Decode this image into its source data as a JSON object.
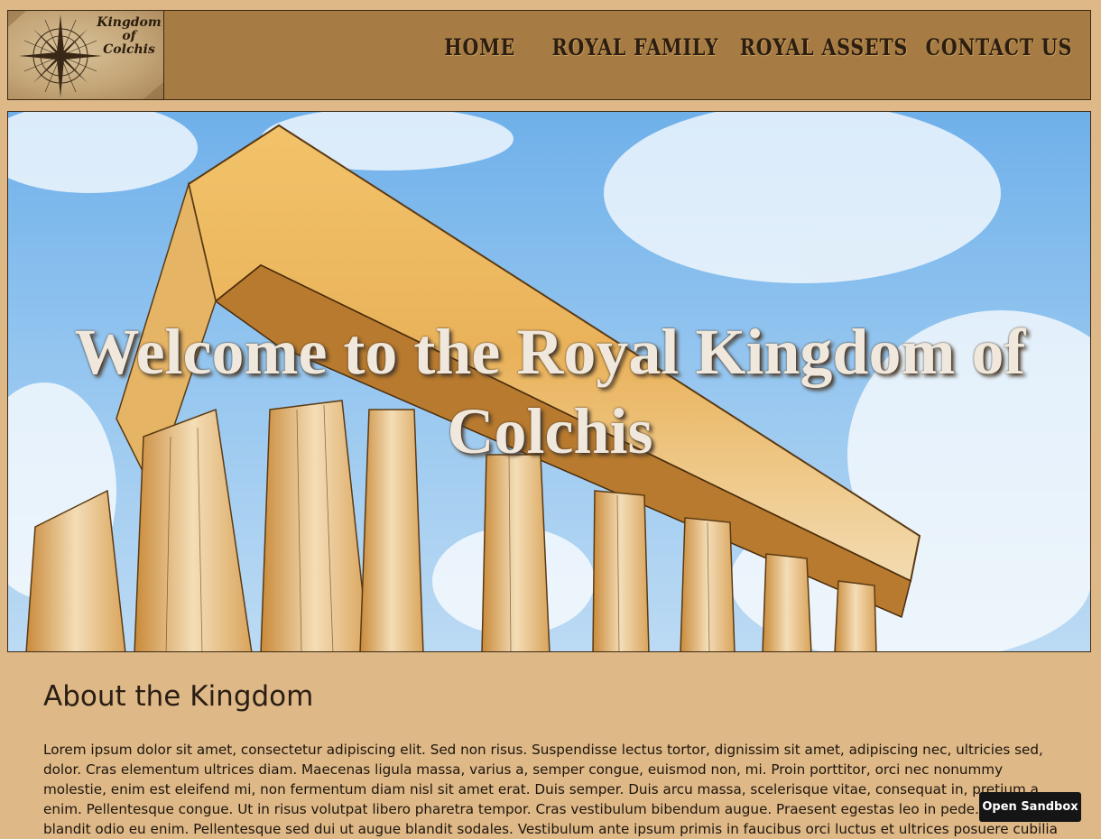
{
  "header": {
    "logo": {
      "line1": "Kingdom",
      "line2": "of",
      "line3": "Colchis"
    },
    "nav": [
      {
        "label": "Home"
      },
      {
        "label": "Royal Family"
      },
      {
        "label": "Royal Assets"
      },
      {
        "label": "Contact Us"
      }
    ]
  },
  "hero": {
    "title": "Welcome to the Royal Kingdom of Colchis"
  },
  "about": {
    "heading": "About the Kingdom",
    "text": "Lorem ipsum dolor sit amet, consectetur adipiscing elit. Sed non risus. Suspendisse lectus tortor, dignissim sit amet, adipiscing nec, ultricies sed, dolor. Cras elementum ultrices diam. Maecenas ligula massa, varius a, semper congue, euismod non, mi. Proin porttitor, orci nec nonummy molestie, enim est eleifend mi, non fermentum diam nisl sit amet erat. Duis semper. Duis arcu massa, scelerisque vitae, consequat in, pretium a, enim. Pellentesque congue. Ut in risus volutpat libero pharetra tempor. Cras vestibulum bibendum augue. Praesent egestas leo in pede. Praesent blandit odio eu enim. Pellentesque sed dui ut augue blandit sodales. Vestibulum ante ipsum primis in faucibus orci luctus et ultrices posuere cubilia Curae; Aliquam nibh."
  },
  "sandbox_button": {
    "label": "Open Sandbox"
  }
}
